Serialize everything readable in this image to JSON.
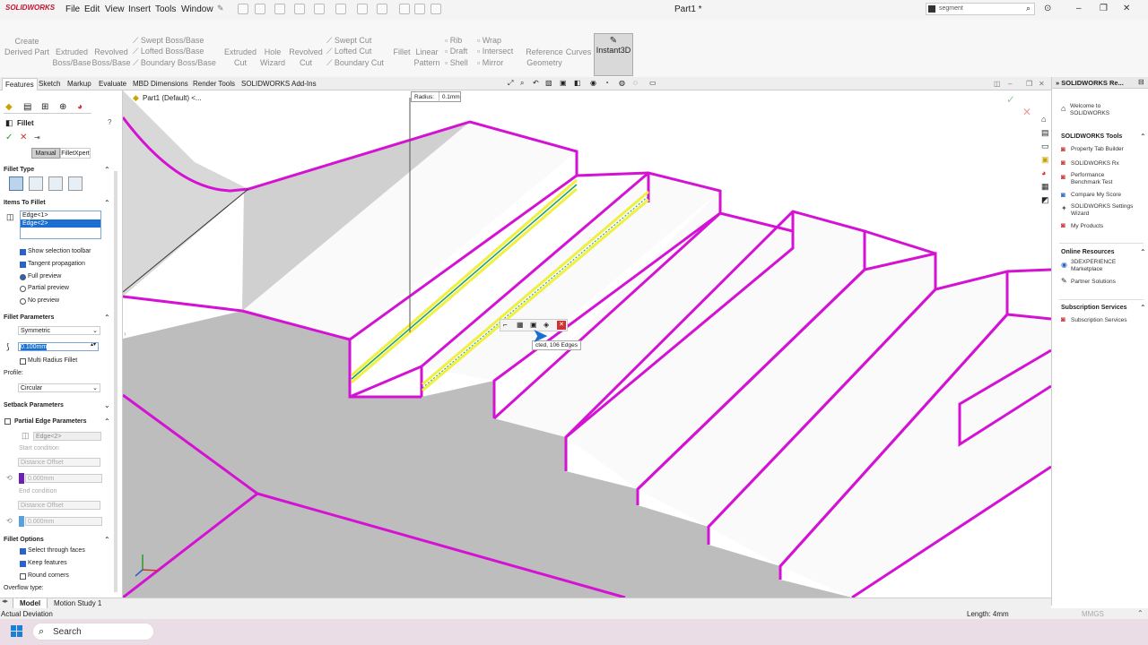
{
  "app": {
    "logo_text": "SOLIDWORKS",
    "document_title": "Part1 *"
  },
  "menus": [
    "File",
    "Edit",
    "View",
    "Insert",
    "Tools",
    "Window"
  ],
  "search": {
    "placeholder": "segment"
  },
  "window_controls": [
    "?",
    "–",
    "❐",
    "✕"
  ],
  "command_manager": {
    "create_derived_part": "Create\nDerived Part",
    "extruded_boss": "Extruded\nBoss/Base",
    "revolved_boss": "Revolved\nBoss/Base",
    "swept_boss": "Swept Boss/Base",
    "lofted_boss": "Lofted Boss/Base",
    "boundary_boss": "Boundary Boss/Base",
    "extruded_cut": "Extruded\nCut",
    "hole_wizard": "Hole\nWizard",
    "revolved_cut": "Revolved\nCut",
    "swept_cut": "Swept Cut",
    "lofted_cut": "Lofted Cut",
    "boundary_cut": "Boundary Cut",
    "fillet": "Fillet",
    "linear_pattern": "Linear\nPattern",
    "rib": "Rib",
    "draft": "Draft",
    "shell": "Shell",
    "wrap": "Wrap",
    "intersect": "Intersect",
    "mirror": "Mirror",
    "reference_geometry": "Reference\nGeometry",
    "curves": "Curves",
    "instant3d": "Instant3D"
  },
  "tabs": [
    "Features",
    "Sketch",
    "Markup",
    "Evaluate",
    "MBD Dimensions",
    "Render Tools",
    "SOLIDWORKS Add-Ins"
  ],
  "tree": {
    "part_label": "Part1 (Default) <..."
  },
  "fillet_panel": {
    "title": "Fillet",
    "mode_manual": "Manual",
    "mode_xpert": "FilletXpert",
    "fillet_type": "Fillet Type",
    "items_to_fillet": "Items To Fillet",
    "edges": [
      "Edge<1>",
      "Edge<2>"
    ],
    "show_selection_toolbar": "Show selection toolbar",
    "tangent_propagation": "Tangent propagation",
    "full_preview": "Full preview",
    "partial_preview": "Partial preview",
    "no_preview": "No preview",
    "fillet_parameters": "Fillet Parameters",
    "method": "Symmetric",
    "radius_value": "0.100mm",
    "multi_radius": "Multi Radius Fillet",
    "profile_label": "Profile:",
    "profile_value": "Circular",
    "setback_parameters": "Setback Parameters",
    "partial_edge_parameters": "Partial Edge Parameters",
    "partial_edge_field": "Edge<2>",
    "start_condition": "Start condition",
    "distance_offset_1": "Distance Offset",
    "offset_value_1": "0.000mm",
    "end_condition": "End condition",
    "distance_offset_2": "Distance Offset",
    "offset_value_2": "0.000mm",
    "fillet_options": "Fillet Options",
    "select_through_faces": "Select through faces",
    "keep_features": "Keep features",
    "round_corners": "Round corners",
    "overflow_type": "Overflow type:"
  },
  "callout": {
    "radius_label": "Radius:",
    "radius_value": "0.1mm"
  },
  "tooltip": {
    "text": "cted, 106 Edges"
  },
  "taskpane": {
    "title": "SOLIDWORKS Re...",
    "welcome": "Welcome to\nSOLIDWORKS",
    "tools_head": "SOLIDWORKS Tools",
    "tools": [
      "Property Tab Builder",
      "SOLIDWORKS Rx",
      "Performance\nBenchmark Test",
      "Compare My Score",
      "SOLIDWORKS Settings\nWizard",
      "My Products"
    ],
    "online_head": "Online Resources",
    "online": [
      "3DEXPERIENCE\nMarketplace",
      "Partner Solutions"
    ],
    "subscription_head": "Subscription Services",
    "subscription": [
      "Subscription Services"
    ]
  },
  "bottom_tabs": [
    "Model",
    "Motion Study 1"
  ],
  "status": {
    "left": "Actual Deviation",
    "length": "Length: 4mm",
    "units": "MMGS"
  },
  "taskbar": {
    "search_label": "Search"
  },
  "colors": {
    "edge": "#d412d4",
    "selected_edge": "#f0f040",
    "highlight_blue": "#1a6fd0",
    "instant3d_bg": "#d9d9d9"
  }
}
